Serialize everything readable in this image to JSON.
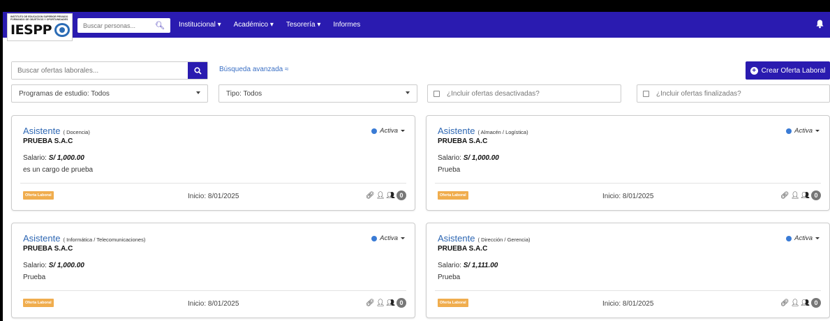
{
  "navbar": {
    "logo_small_text": "INSTITUTO DE EDUCACION SUPERIOR PRIVADO\nFORMANDO DE OBJETIVOS Y OPORTUNIDADES",
    "logo_text": "IESPP",
    "search_placeholder": "Buscar personas...",
    "menu": [
      "Institucional ▾",
      "Académico ▾",
      "Tesorería ▾",
      "Informes"
    ],
    "colors": {
      "primary": "#2a1bb0"
    }
  },
  "toolbar": {
    "search_placeholder": "Buscar ofertas laborales...",
    "advanced_link": "Búsqueda avanzada ≈",
    "create_button": "Crear Oferta Laboral",
    "program_select": "Programas de estudio: Todos",
    "type_select": "Tipo: Todos",
    "include_deactivated": "¿Incluir ofertas desactivadas?",
    "include_finished": "¿Incluir ofertas finalizadas?"
  },
  "cards": [
    {
      "title": "Asistente",
      "area": "( Docencia)",
      "company": "PRUEBA S.A.C",
      "salary_label": "Salario:",
      "salary": "S/ 1,000.00",
      "description": "es un cargo de prueba",
      "status": "Activa",
      "badge": "Oferta Laboral",
      "start": "Inicio: 8/01/2025",
      "count": "0"
    },
    {
      "title": "Asistente",
      "area": "( Almacén / Logística)",
      "company": "PRUEBA S.A.C",
      "salary_label": "Salario:",
      "salary": "S/ 1,000.00",
      "description": "Prueba",
      "status": "Activa",
      "badge": "Oferta Laboral",
      "start": "Inicio: 8/01/2025",
      "count": "0"
    },
    {
      "title": "Asistente",
      "area": "( Informática / Telecomunicaciones)",
      "company": "PRUEBA S.A.C",
      "salary_label": "Salario:",
      "salary": "S/ 1,000.00",
      "description": "Prueba",
      "status": "Activa",
      "badge": "Oferta Laboral",
      "start": "Inicio: 8/01/2025",
      "count": "0"
    },
    {
      "title": "Asistente",
      "area": "( Dirección / Gerencia)",
      "company": "PRUEBA S.A.C",
      "salary_label": "Salario:",
      "salary": "S/ 1,111.00",
      "description": "Prueba",
      "status": "Activa",
      "badge": "Oferta Laboral",
      "start": "Inicio: 8/01/2025",
      "count": "0"
    }
  ]
}
